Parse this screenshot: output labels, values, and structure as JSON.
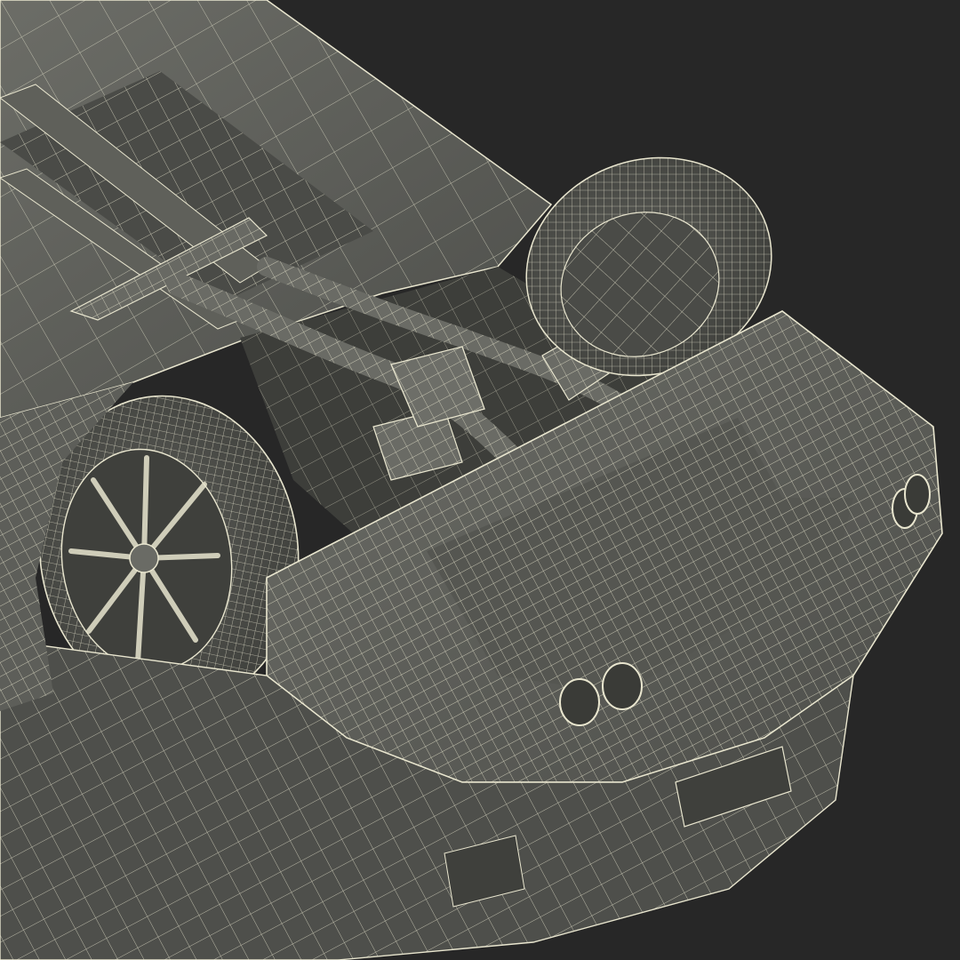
{
  "scene": {
    "subject": "wireframe-car-underside",
    "background_color": "#272727",
    "surface_color": "#595a55",
    "surface_shadow_color": "#3d3e3a",
    "surface_light_color": "#6c6d67",
    "wire_color": "#e9e6cf",
    "wire_dim_color": "#b9b6a2"
  }
}
